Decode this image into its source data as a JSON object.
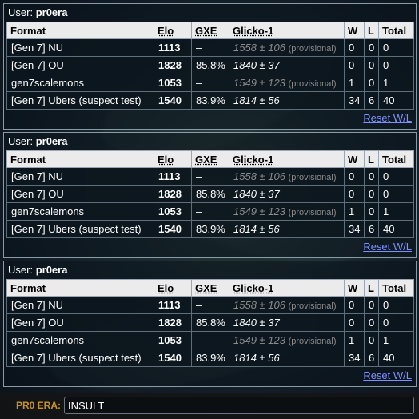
{
  "ladders": [
    {
      "user_label": "User:",
      "username": "pr0era",
      "headers": {
        "format": "Format",
        "elo": "Elo",
        "gxe": "GXE",
        "glicko": "Glicko-1",
        "w": "W",
        "l": "L",
        "total": "Total"
      },
      "rows": [
        {
          "format": "[Gen 7] NU",
          "elo": "1113",
          "gxe": "–",
          "glicko": "1558 ± 106",
          "provisional": "(provisional)",
          "w": "0",
          "l": "0",
          "total": "0"
        },
        {
          "format": "[Gen 7] OU",
          "elo": "1828",
          "gxe": "85.8%",
          "glicko": "1840 ± 37",
          "provisional": "",
          "w": "0",
          "l": "0",
          "total": "0"
        },
        {
          "format": "gen7scalemons",
          "elo": "1053",
          "gxe": "–",
          "glicko": "1549 ± 123",
          "provisional": "(provisional)",
          "w": "1",
          "l": "0",
          "total": "1"
        },
        {
          "format": "[Gen 7] Ubers (suspect test)",
          "elo": "1540",
          "gxe": "83.9%",
          "glicko": "1814 ± 56",
          "provisional": "",
          "w": "34",
          "l": "6",
          "total": "40"
        }
      ],
      "reset_label": "Reset W/L"
    },
    {
      "user_label": "User:",
      "username": "pr0era",
      "headers": {
        "format": "Format",
        "elo": "Elo",
        "gxe": "GXE",
        "glicko": "Glicko-1",
        "w": "W",
        "l": "L",
        "total": "Total"
      },
      "rows": [
        {
          "format": "[Gen 7] NU",
          "elo": "1113",
          "gxe": "–",
          "glicko": "1558 ± 106",
          "provisional": "(provisional)",
          "w": "0",
          "l": "0",
          "total": "0"
        },
        {
          "format": "[Gen 7] OU",
          "elo": "1828",
          "gxe": "85.8%",
          "glicko": "1840 ± 37",
          "provisional": "",
          "w": "0",
          "l": "0",
          "total": "0"
        },
        {
          "format": "gen7scalemons",
          "elo": "1053",
          "gxe": "–",
          "glicko": "1549 ± 123",
          "provisional": "(provisional)",
          "w": "1",
          "l": "0",
          "total": "1"
        },
        {
          "format": "[Gen 7] Ubers (suspect test)",
          "elo": "1540",
          "gxe": "83.9%",
          "glicko": "1814 ± 56",
          "provisional": "",
          "w": "34",
          "l": "6",
          "total": "40"
        }
      ],
      "reset_label": "Reset W/L"
    },
    {
      "user_label": "User:",
      "username": "pr0era",
      "headers": {
        "format": "Format",
        "elo": "Elo",
        "gxe": "GXE",
        "glicko": "Glicko-1",
        "w": "W",
        "l": "L",
        "total": "Total"
      },
      "rows": [
        {
          "format": "[Gen 7] NU",
          "elo": "1113",
          "gxe": "–",
          "glicko": "1558 ± 106",
          "provisional": "(provisional)",
          "w": "0",
          "l": "0",
          "total": "0"
        },
        {
          "format": "[Gen 7] OU",
          "elo": "1828",
          "gxe": "85.8%",
          "glicko": "1840 ± 37",
          "provisional": "",
          "w": "0",
          "l": "0",
          "total": "0"
        },
        {
          "format": "gen7scalemons",
          "elo": "1053",
          "gxe": "–",
          "glicko": "1549 ± 123",
          "provisional": "(provisional)",
          "w": "1",
          "l": "0",
          "total": "1"
        },
        {
          "format": "[Gen 7] Ubers (suspect test)",
          "elo": "1540",
          "gxe": "83.9%",
          "glicko": "1814 ± 56",
          "provisional": "",
          "w": "34",
          "l": "6",
          "total": "40"
        }
      ],
      "reset_label": "Reset W/L"
    }
  ],
  "chat": {
    "label": "PR0 ERA:",
    "value": "INSULT"
  },
  "colors": {
    "link": "#7f8fff",
    "chat_label": "#c8921e",
    "provisional": "#8c8c8c"
  }
}
